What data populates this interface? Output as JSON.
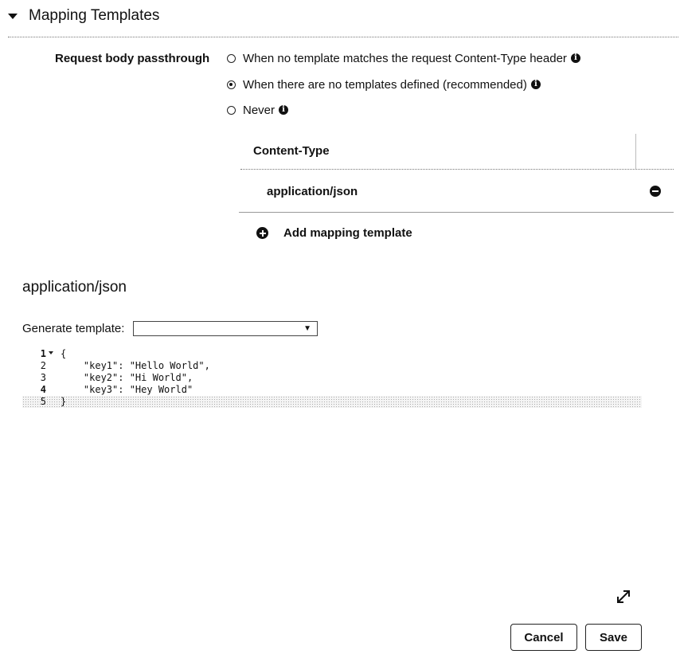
{
  "section": {
    "title": "Mapping Templates"
  },
  "passthrough": {
    "label": "Request body passthrough",
    "options": [
      {
        "label": "When no template matches the request Content-Type header",
        "selected": false
      },
      {
        "label": "When there are no templates defined (recommended)",
        "selected": true
      },
      {
        "label": "Never",
        "selected": false
      }
    ]
  },
  "content_type_table": {
    "header": "Content-Type",
    "rows": [
      {
        "value": "application/json"
      }
    ],
    "add_label": "Add mapping template"
  },
  "template": {
    "title": "application/json",
    "generate_label": "Generate template:",
    "generate_selected": "",
    "code_lines": [
      {
        "num": "1",
        "text": "{"
      },
      {
        "num": "2",
        "text": "    \"key1\": \"Hello World\","
      },
      {
        "num": "3",
        "text": "    \"key2\": \"Hi World\","
      },
      {
        "num": "4",
        "text": "    \"key3\": \"Hey World\""
      },
      {
        "num": "5",
        "text": "}"
      }
    ]
  },
  "buttons": {
    "cancel": "Cancel",
    "save": "Save"
  },
  "icons": {
    "caret": "caret-down-icon",
    "info": "info-icon",
    "remove": "minus-circle-icon",
    "add": "plus-circle-icon",
    "expand": "expand-icon"
  }
}
